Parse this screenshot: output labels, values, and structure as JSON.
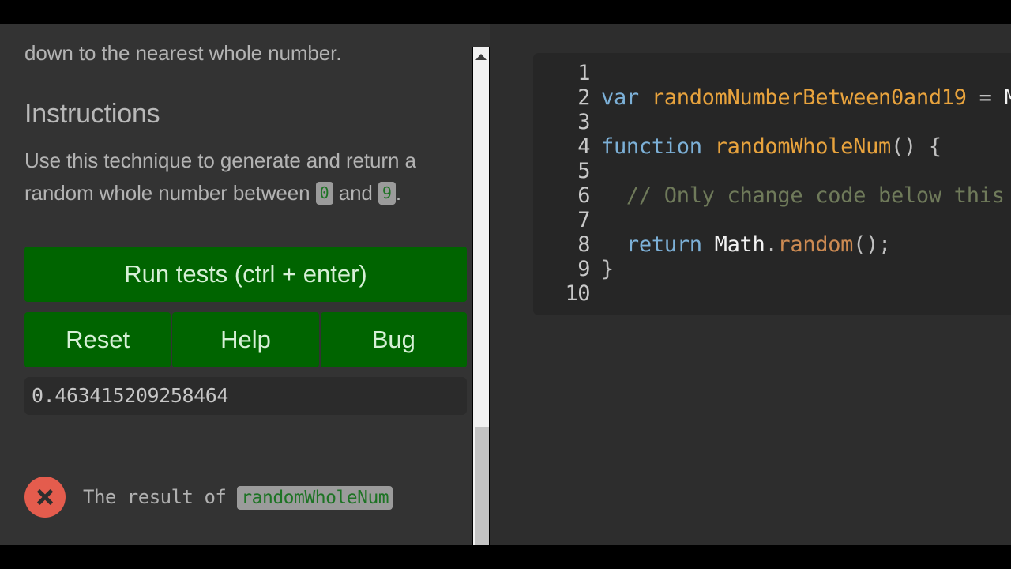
{
  "app": {
    "background_color": "#2a2a2a",
    "panel_color": "#333333",
    "accent_green": "#006400",
    "highlight_color": "#f5f01e"
  },
  "sidebar": {
    "intro_paragraph": "down to the nearest whole number.",
    "section_title": "Instructions",
    "instructions": {
      "text_before": "Use this technique to generate and return a random whole number between ",
      "code_min": "0",
      "text_middle": " and ",
      "code_max": "9",
      "text_after": "."
    },
    "buttons": {
      "run_tests": "Run tests (ctrl + enter)",
      "reset": "Reset",
      "help": "Help",
      "bug": "Bug"
    },
    "console_output": "0.463415209258464",
    "test_result": {
      "status_icon": "fail-circle-x-icon",
      "text_before": "The result of ",
      "code_ref": "randomWholeNum"
    },
    "scrollbar": {
      "up_arrow_icon": "caret-up-icon",
      "thumb_label": "vertical-scroll-thumb"
    }
  },
  "editor": {
    "lines": [
      {
        "number": "1",
        "tokens": []
      },
      {
        "number": "2",
        "tokens": [
          {
            "t": "var ",
            "c": "tok-kw"
          },
          {
            "t": "randomNumberBetween0and19",
            "c": "tok-var"
          },
          {
            "t": " = ",
            "c": "tok-punct"
          },
          {
            "t": "M",
            "c": "tok-obj"
          }
        ]
      },
      {
        "number": "3",
        "tokens": []
      },
      {
        "number": "4",
        "tokens": [
          {
            "t": "function ",
            "c": "tok-kw"
          },
          {
            "t": "randomWholeNum",
            "c": "tok-fn"
          },
          {
            "t": "() {",
            "c": "tok-punct"
          }
        ]
      },
      {
        "number": "5",
        "tokens": []
      },
      {
        "number": "6",
        "tokens": [
          {
            "t": "  // Only change code below this",
            "c": "tok-comment"
          }
        ]
      },
      {
        "number": "7",
        "tokens": []
      },
      {
        "number": "8",
        "tokens": [
          {
            "t": "  return ",
            "c": "tok-kw"
          },
          {
            "t": "Math",
            "c": "tok-obj"
          },
          {
            "t": ".",
            "c": "tok-punct"
          },
          {
            "t": "random",
            "c": "tok-method"
          },
          {
            "t": "();",
            "c": "tok-punct"
          }
        ]
      },
      {
        "number": "9",
        "tokens": [
          {
            "t": "}",
            "c": "tok-punct"
          }
        ]
      },
      {
        "number": "10",
        "tokens": []
      }
    ]
  }
}
